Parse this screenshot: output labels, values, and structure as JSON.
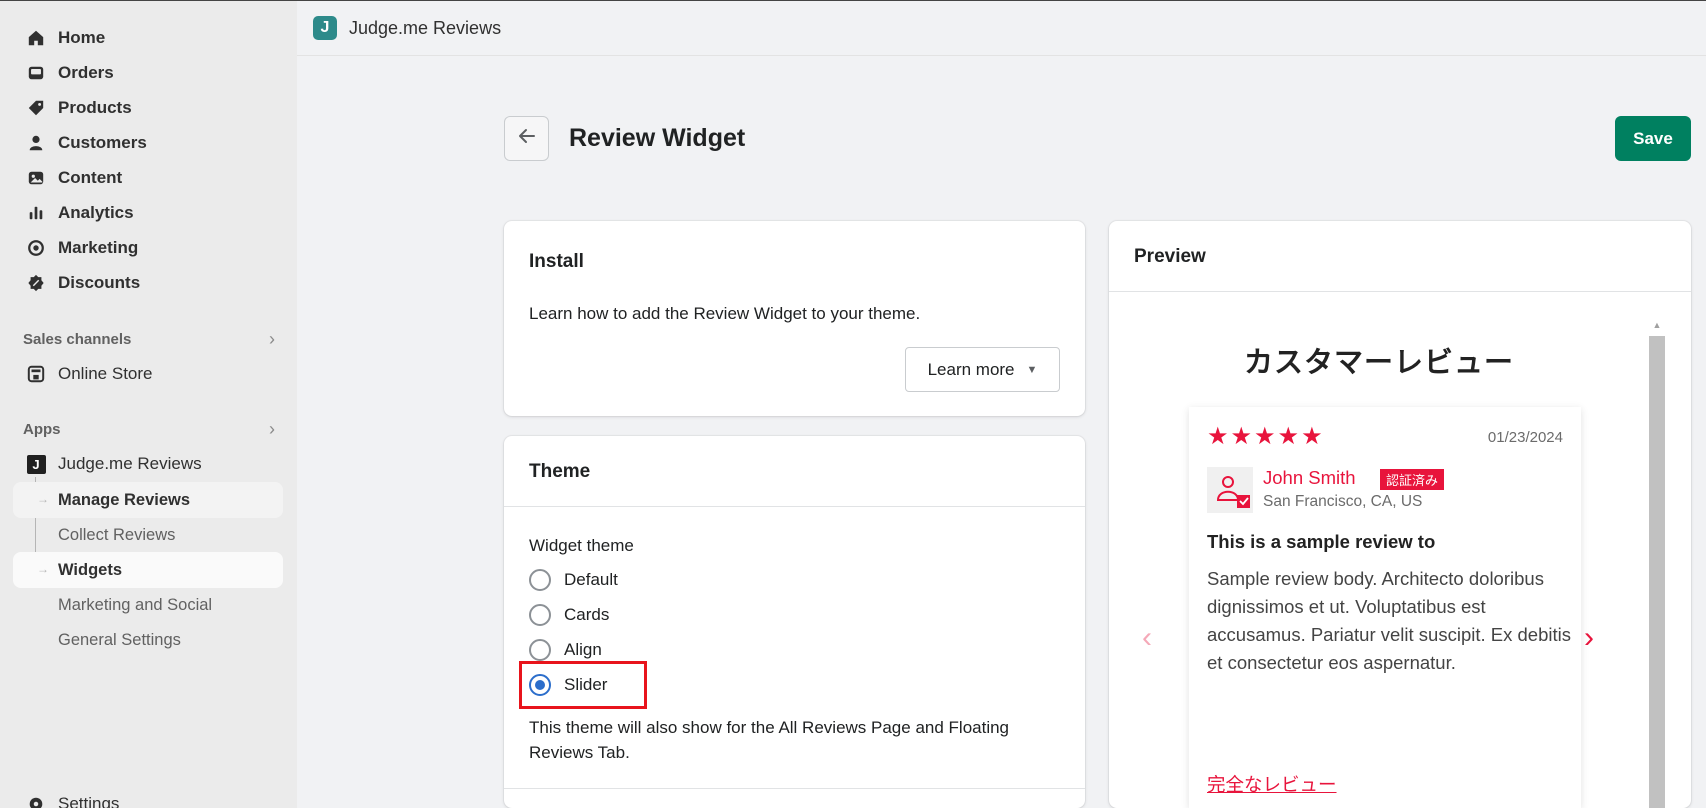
{
  "sidebar": {
    "nav": [
      {
        "label": "Home",
        "icon": "home-icon"
      },
      {
        "label": "Orders",
        "icon": "inbox-icon"
      },
      {
        "label": "Products",
        "icon": "tag-icon"
      },
      {
        "label": "Customers",
        "icon": "person-icon"
      },
      {
        "label": "Content",
        "icon": "image-icon"
      },
      {
        "label": "Analytics",
        "icon": "bar-chart-icon"
      },
      {
        "label": "Marketing",
        "icon": "target-icon"
      },
      {
        "label": "Discounts",
        "icon": "discount-icon"
      }
    ],
    "sales_channels_label": "Sales channels",
    "online_store_label": "Online Store",
    "apps_label": "Apps",
    "app_label": "Judge.me Reviews",
    "app_icon_letter": "J",
    "sub_items": [
      "Manage Reviews",
      "Collect Reviews",
      "Widgets",
      "Marketing and Social",
      "General Settings"
    ],
    "settings_label": "Settings"
  },
  "appbar": {
    "logo_letter": "J",
    "title": "Judge.me Reviews"
  },
  "page": {
    "title": "Review Widget",
    "save_label": "Save"
  },
  "install": {
    "title": "Install",
    "description": "Learn how to add the Review Widget to your theme.",
    "learn_more_label": "Learn more"
  },
  "theme": {
    "title": "Theme",
    "widget_theme_label": "Widget theme",
    "options": [
      "Default",
      "Cards",
      "Align",
      "Slider"
    ],
    "selected": "Slider",
    "note": "This theme will also show for the All Reviews Page and Floating Reviews Tab."
  },
  "preview": {
    "title": "Preview",
    "heading": "カスタマーレビュー",
    "review": {
      "rating": 5,
      "date": "01/23/2024",
      "name": "John Smith",
      "verified_badge": "認証済み",
      "location": "San Francisco, CA, US",
      "title": "This is a sample review to",
      "body": "Sample review body. Architecto doloribus dignissimos et ut. Voluptatibus est accusamus. Pariatur velit suscipit. Ex debitis et consectetur eos aspernatur.",
      "full_review_link": "完全なレビュー"
    }
  },
  "colors": {
    "accent": "#e8143c",
    "save": "#008060",
    "radio": "#2c6ecb",
    "highlight": "#e8141c"
  }
}
